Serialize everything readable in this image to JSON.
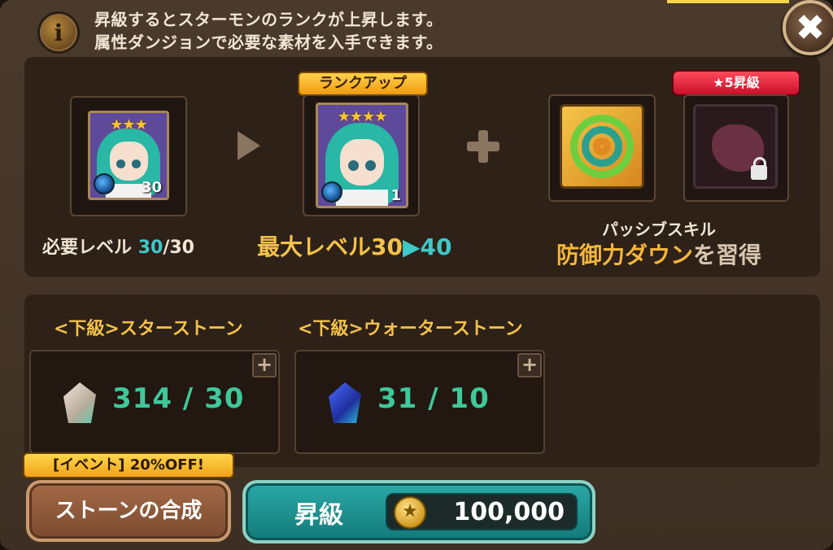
{
  "info": {
    "line1": "昇級するとスターモンのランクが上昇します。",
    "line2": "属性ダンジョンで必要な素材を入手できます。",
    "icon": "info-icon"
  },
  "close": {
    "glyph": "✖",
    "icon": "close-icon"
  },
  "current_monster": {
    "stars": "★★★",
    "level": "30"
  },
  "rankup_badge": "ランクアップ",
  "next_monster": {
    "stars": "★★★★",
    "level": "1"
  },
  "star5_badge": "★5昇級",
  "required_level": {
    "label": "必要レベル",
    "current": "30",
    "max": "/30"
  },
  "max_level": {
    "label": "最大レベル30",
    "arrow": "▶",
    "new": "40"
  },
  "passive": {
    "title": "パッシブスキル",
    "skill": "防御力ダウン",
    "suffix": "を習得"
  },
  "materials": [
    {
      "label": "<下級>スターストーン",
      "count": "314 / 30",
      "plus": "+"
    },
    {
      "label": "<下級>ウォーターストーン",
      "count": "31 / 10",
      "plus": "+"
    }
  ],
  "event_badge": "[イベント] 20%OFF!",
  "synth_button": "ストーンの合成",
  "rankup_button": {
    "label": "昇級",
    "cost": "100,000",
    "coin_glyph": "★"
  },
  "colors": {
    "accent_gold": "#f4c24a",
    "accent_teal": "#3fc8c8",
    "count_green": "#3fc89a"
  }
}
